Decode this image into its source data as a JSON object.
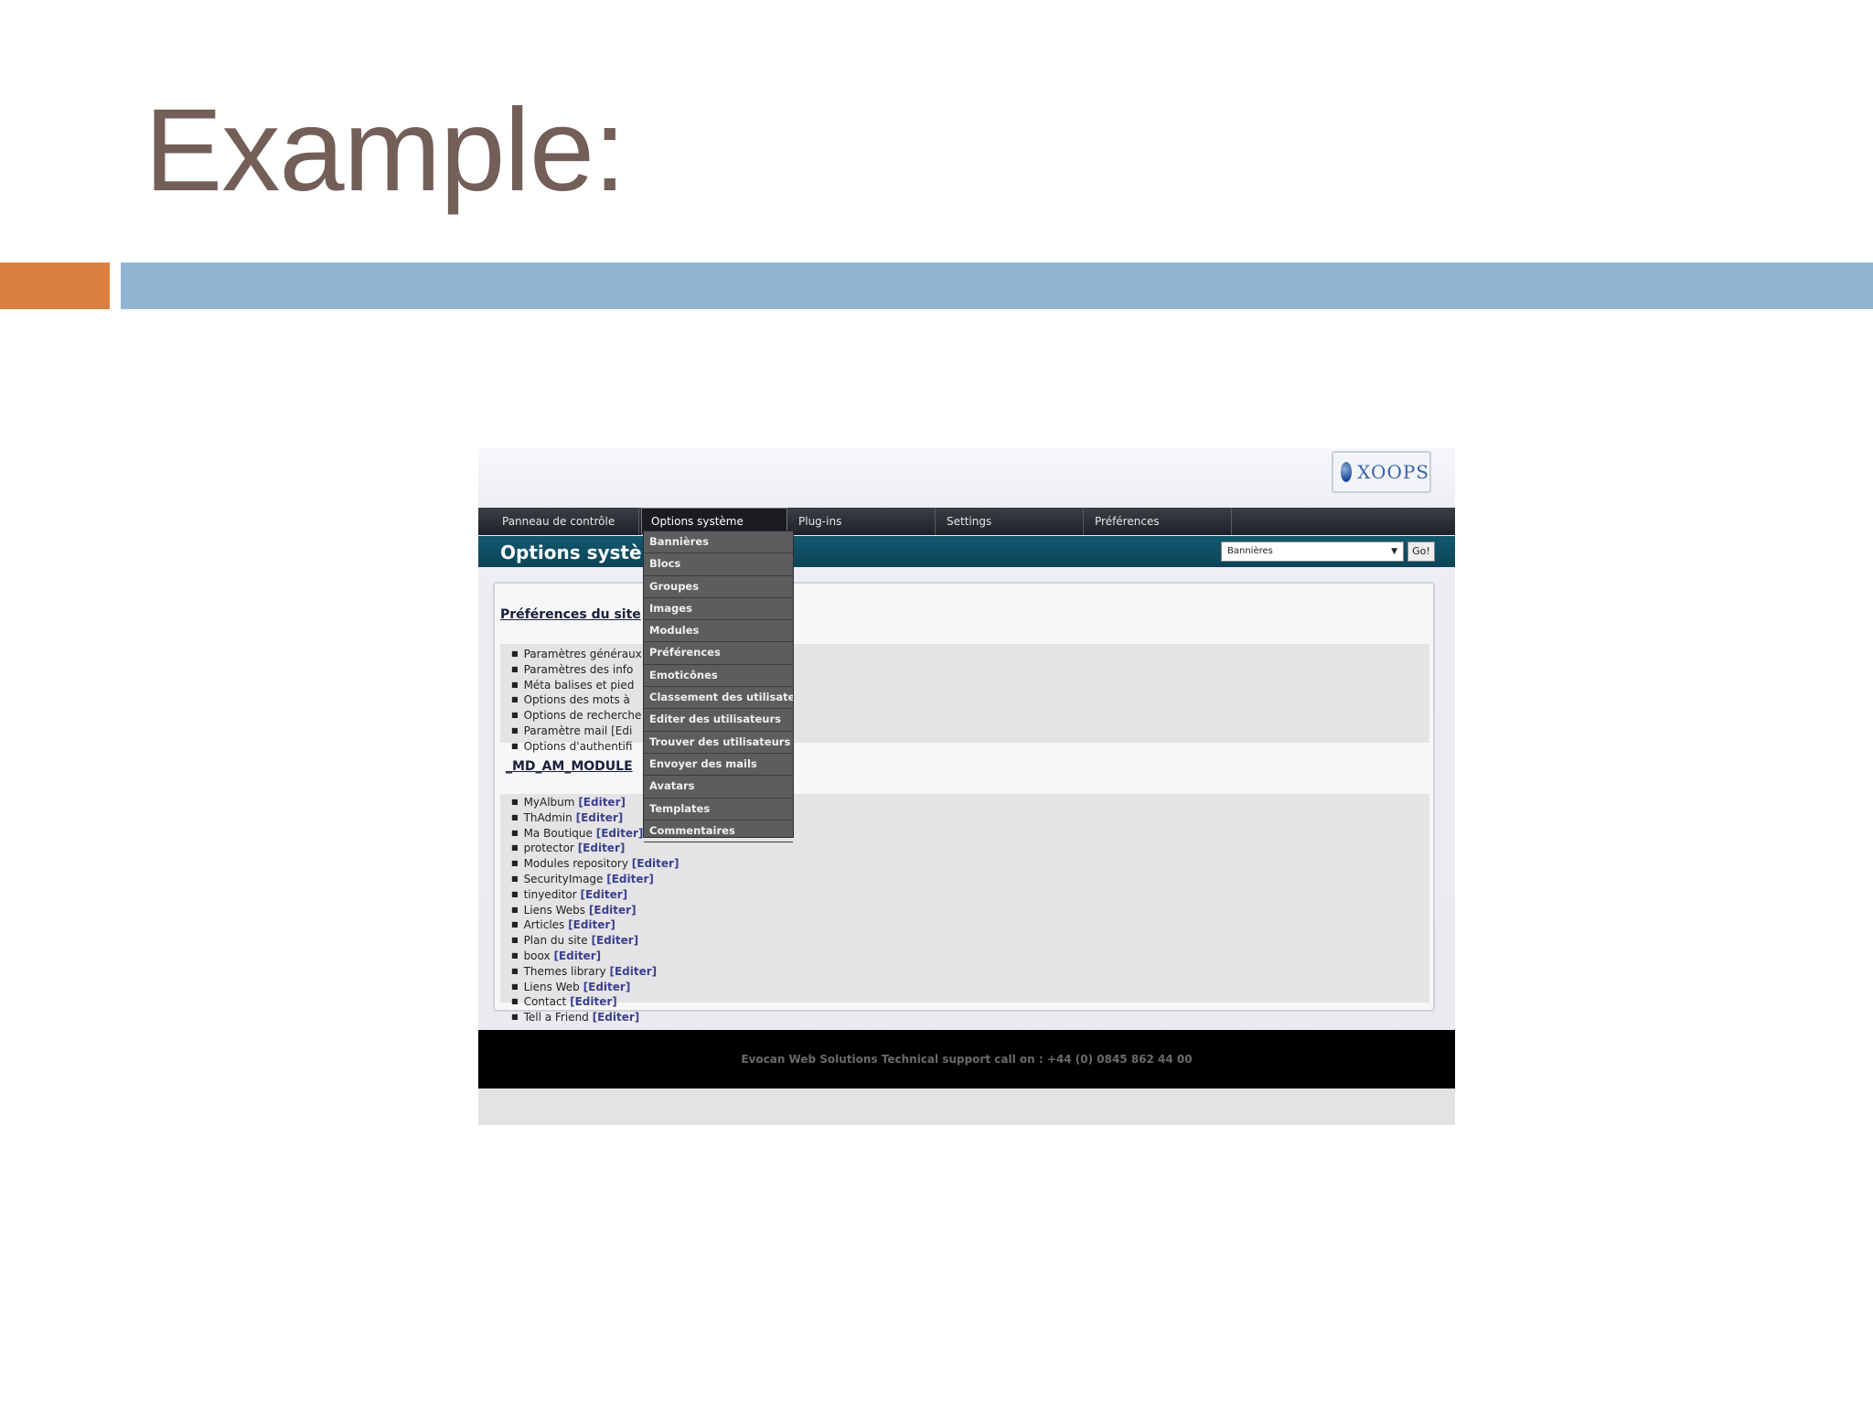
{
  "slide": {
    "title": "Example:",
    "colors": {
      "title": "#735f58",
      "accent_bar": "#d9803f",
      "main_bar": "#92b4d2"
    }
  },
  "screenshot": {
    "logo_text": "XOOPS",
    "menubar": {
      "items": [
        "Panneau de contrôle",
        "Options système",
        "Plug-ins",
        "Settings",
        "Préférences"
      ],
      "active_index": 1
    },
    "subheader": {
      "title": "Options systèm",
      "module_select_value": "Bannières",
      "go_label": "Go!"
    },
    "dropdown": {
      "items": [
        "Bannières",
        "Blocs",
        "Groupes",
        "Images",
        "Modules",
        "Préférences",
        "Emoticônes",
        "Classement des utilisateurs",
        "Editer des utilisateurs",
        "Trouver des utilisateurs",
        "Envoyer des mails",
        "Avatars",
        "Templates",
        "Commentaires"
      ]
    },
    "site_preferences": {
      "title": "Préférences du site",
      "items": [
        "Paramètres généraux",
        "Paramètres des info",
        "Méta balises et pied",
        "Options des mots à",
        "Options de recherche",
        "Paramètre mail [Edi",
        "Options d'authentifi"
      ]
    },
    "modules": {
      "title": "_MD_AM_MODULE",
      "edit_label": "[Editer]",
      "items": [
        "MyAlbum",
        "ThAdmin",
        "Ma Boutique",
        "protector",
        "Modules repository",
        "SecurityImage",
        "tinyeditor",
        "Liens Webs",
        "Articles",
        "Plan du site",
        "boox",
        "Themes library",
        "Liens Web",
        "Contact",
        "Tell a Friend"
      ]
    },
    "footer_text": "Evocan Web Solutions Technical support call on : +44 (0) 0845 862 44 00"
  }
}
